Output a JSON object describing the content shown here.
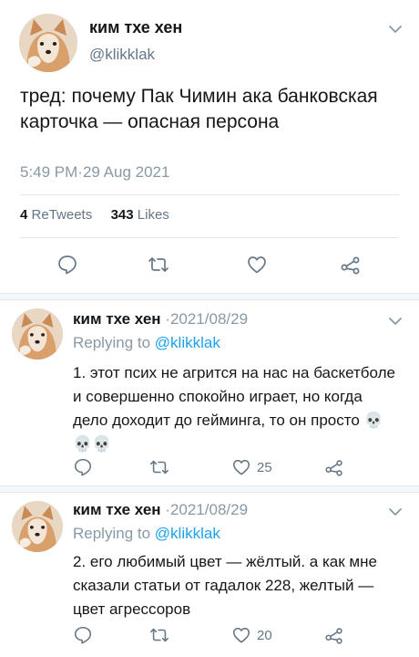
{
  "main_tweet": {
    "name": "ким тхе хен",
    "handle": "@klikklak",
    "text": "тред: почему Пак Чимин ака банковская карточка — опасная персона",
    "timestamp": "5:49 PM·29 Aug 2021",
    "retweets_count": "4",
    "retweets_label": "ReTweets",
    "likes_count": "343",
    "likes_label": "Likes"
  },
  "replies": [
    {
      "name": "ким тхе хен",
      "date": "·2021/08/29",
      "replying_prefix": "Replying to ",
      "replying_handle": "@klikklak",
      "text": "1. этот псих не агрится на нас на баскетболе и совершенно спокойно играет, но когда дело доходит до гейминга, то он просто 💀💀💀",
      "likes": "25"
    },
    {
      "name": "ким тхе хен",
      "date": "·2021/08/29",
      "replying_prefix": "Replying to ",
      "replying_handle": "@klikklak",
      "text": "2. его любимый цвет — жёлтый. а как мне сказали статьи от гадалок 228, желтый — цвет агрессоров",
      "likes": "20"
    }
  ],
  "icons": [
    "avatar-dog",
    "chevron-down-icon",
    "reply-icon",
    "retweet-icon",
    "like-icon",
    "share-icon"
  ],
  "colors": {
    "text": "#14171a",
    "muted": "#657786",
    "light_muted": "#8899a6",
    "link": "#1da1f2",
    "divider": "#e1e8ed"
  }
}
